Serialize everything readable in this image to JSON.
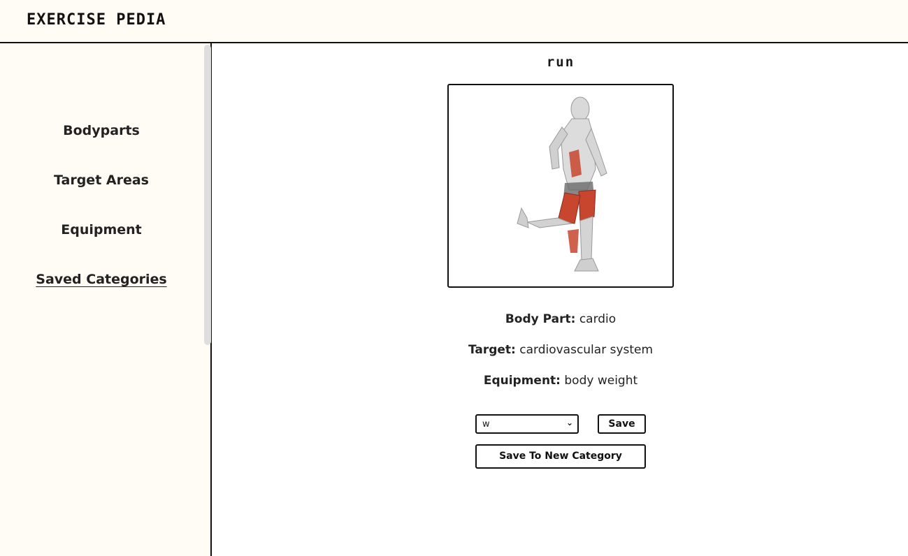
{
  "app": {
    "title": "EXERCISE PEDIA"
  },
  "sidebar": {
    "items": [
      {
        "label": "Bodyparts",
        "active": false
      },
      {
        "label": "Target Areas",
        "active": false
      },
      {
        "label": "Equipment",
        "active": false
      },
      {
        "label": "Saved Categories",
        "active": true
      }
    ]
  },
  "exercise": {
    "name": "run",
    "body_part_label": "Body Part:",
    "body_part": "cardio",
    "target_label": "Target:",
    "target": "cardiovascular system",
    "equipment_label": "Equipment:",
    "equipment": "body weight"
  },
  "actions": {
    "category_select_value": "w",
    "save_label": "Save",
    "save_new_label": "Save To New Category"
  },
  "colors": {
    "panel_bg": "#fffbf5",
    "border": "#111111",
    "muscle_highlight": "#c8452e"
  }
}
